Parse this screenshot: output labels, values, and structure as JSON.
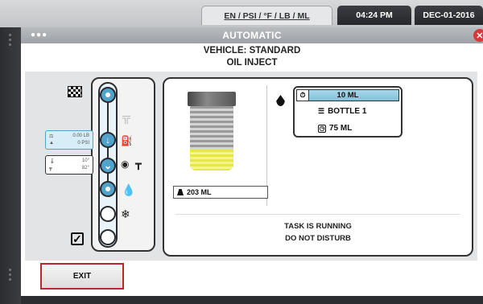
{
  "topbar": {
    "units": "EN / PSI / °F / LB / ML",
    "time": "04:24 PM",
    "date": "DEC-01-2016"
  },
  "window": {
    "title": "AUTOMATIC",
    "vehicle": "VEHICLE: STANDARD",
    "mode": "OIL INJECT"
  },
  "sidebar_readouts": {
    "ambient": {
      "top": "0.00 LB",
      "bottom": "0 PSI"
    },
    "temp": {
      "top": "10°",
      "bottom": "82°"
    }
  },
  "steps": [
    {
      "name": "start",
      "icon": "checkered-flag-icon",
      "state": "done"
    },
    {
      "name": "vacuum",
      "icon": "valve-icon",
      "state": "skipped"
    },
    {
      "name": "recover",
      "icon": "hose-icon",
      "state": "done"
    },
    {
      "name": "leak-test",
      "icon": "gauge-icon",
      "state": "done"
    },
    {
      "name": "oil-inject",
      "icon": "oil-drop-icon",
      "state": "active"
    },
    {
      "name": "charge",
      "icon": "snowflake-icon",
      "state": "pending"
    },
    {
      "name": "finish",
      "icon": "checkbox-icon",
      "state": "pending"
    }
  ],
  "bottle": {
    "fill_fraction": 0.33,
    "volume_label": "203 ML"
  },
  "inject": {
    "dose": "10 ML",
    "bottle": "BOTTLE 1",
    "total": "75 ML"
  },
  "status": {
    "line1": "TASK IS RUNNING",
    "line2": "DO NOT DISTURB"
  },
  "buttons": {
    "exit": "EXIT"
  },
  "colors": {
    "accent": "#4fa3cc",
    "oil": "#e6e64a",
    "close": "#d9363a",
    "exit_border": "#b8282e"
  }
}
